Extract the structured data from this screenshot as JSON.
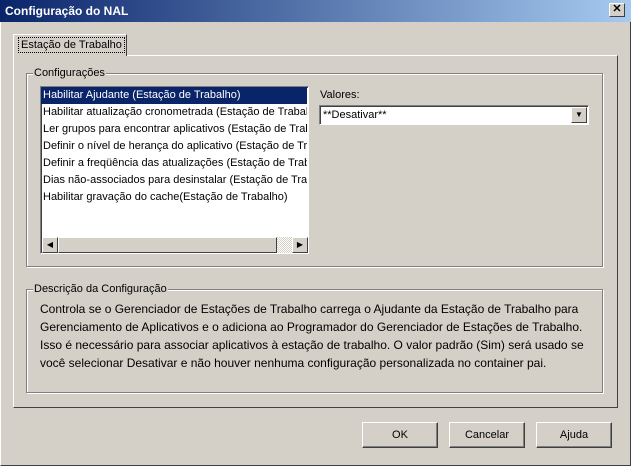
{
  "window": {
    "title": "Configuração do NAL",
    "close_glyph": "✕"
  },
  "tabs": [
    {
      "label": "Estação de Trabalho"
    }
  ],
  "settings_group": {
    "title": "Configurações",
    "items": [
      {
        "label": "Habilitar Ajudante (Estação de Trabalho)",
        "selected": true
      },
      {
        "label": "Habilitar atualização cronometrada (Estação de Trabalh",
        "selected": false
      },
      {
        "label": "Ler grupos para encontrar aplicativos (Estação de Trab",
        "selected": false
      },
      {
        "label": "Definir o nível de herança do aplicativo (Estação de Tra",
        "selected": false
      },
      {
        "label": "Definir a freqüência das atualizações (Estação de Trab",
        "selected": false
      },
      {
        "label": "Dias não-associados para desinstalar (Estação de Trab",
        "selected": false
      },
      {
        "label": "Habilitar gravação do cache(Estação de Trabalho)",
        "selected": false
      }
    ],
    "valores_label": "Valores:",
    "valores_value": "**Desativar**"
  },
  "description_group": {
    "title": "Descrição da Configuração",
    "text": "Controla se o Gerenciador de Estações de Trabalho carrega o Ajudante da Estação de Trabalho para Gerenciamento de Aplicativos e o adiciona ao Programador do Gerenciador de Estações de Trabalho. Isso é necessário para associar aplicativos à estação de trabalho. O valor padrão (Sim) será usado se você selecionar Desativar e não houver nenhuma configuração personalizada no container pai."
  },
  "buttons": {
    "ok": "OK",
    "cancel": "Cancelar",
    "help": "Ajuda"
  },
  "icons": {
    "scroll_left": "◀",
    "scroll_right": "▶",
    "dropdown": "▼"
  },
  "colors": {
    "titlebar_start": "#0a246a",
    "titlebar_end": "#a6caf0",
    "selection": "#0a246a",
    "face": "#d4d0c8"
  }
}
